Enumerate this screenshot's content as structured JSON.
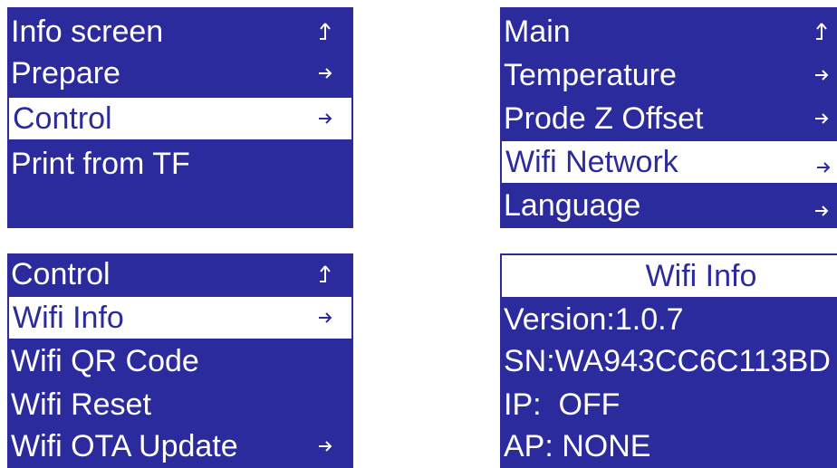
{
  "main_menu": {
    "items": [
      {
        "label": "Info screen",
        "icon": "return-icon"
      },
      {
        "label": "Prepare",
        "icon": "arrow-right-icon"
      },
      {
        "label": "Control",
        "icon": "arrow-right-icon",
        "selected": true
      },
      {
        "label": "Print from TF",
        "icon": ""
      }
    ]
  },
  "control_menu": {
    "items": [
      {
        "label": "Main",
        "icon": "return-icon"
      },
      {
        "label": "Temperature",
        "icon": "arrow-right-icon"
      },
      {
        "label": "Prode Z Offset",
        "icon": "arrow-right-icon"
      },
      {
        "label": "Wifi Network",
        "icon": "arrow-right-icon",
        "selected": true
      },
      {
        "label": "Language",
        "icon": "arrow-right-icon"
      }
    ]
  },
  "wifi_menu": {
    "items": [
      {
        "label": "Control",
        "icon": "return-icon"
      },
      {
        "label": "Wifi Info",
        "icon": "arrow-right-icon",
        "selected": true
      },
      {
        "label": "Wifi QR Code",
        "icon": ""
      },
      {
        "label": "Wifi Reset",
        "icon": ""
      },
      {
        "label": "Wifi OTA Update",
        "icon": "arrow-right-icon"
      }
    ]
  },
  "wifi_info": {
    "title": "Wifi Info",
    "version": "Version:1.0.7",
    "sn": "SN:WA943CC6C113BD",
    "ip": "IP:  OFF",
    "ap": "AP: NONE"
  },
  "colors": {
    "screen_bg": "#2b2b9e",
    "highlight_bg": "#ffffff",
    "text": "#ffffff"
  }
}
